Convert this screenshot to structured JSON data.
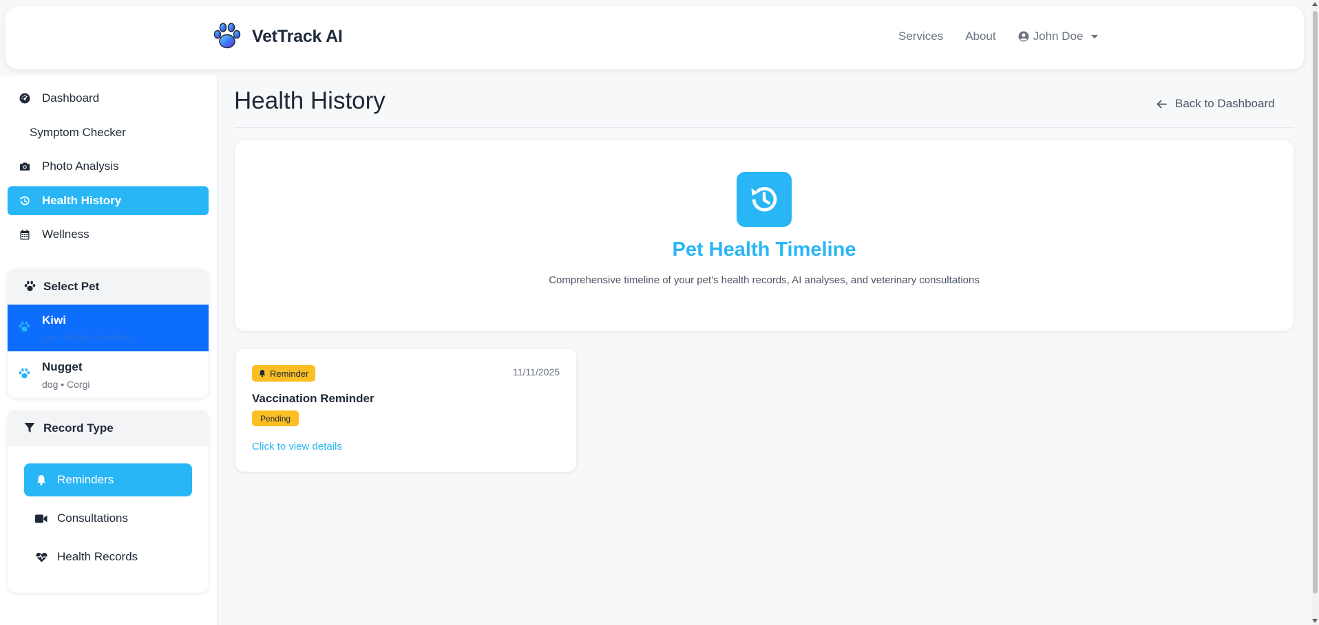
{
  "header": {
    "brand_name": "VetTrack AI",
    "nav": [
      "Services",
      "About"
    ],
    "user_name": "John Doe"
  },
  "sidebar": {
    "items": [
      {
        "label": "Dashboard",
        "icon": "gauge-icon",
        "active": false
      },
      {
        "label": "Symptom Checker",
        "icon": "",
        "active": false
      },
      {
        "label": "Photo Analysis",
        "icon": "camera-icon",
        "active": true
      },
      {
        "label": "Health History",
        "icon": "history-icon",
        "active": true
      },
      {
        "label": "Wellness",
        "icon": "calendar-icon",
        "active": false
      }
    ],
    "select_pet": {
      "title": "Select Pet",
      "pets": [
        {
          "name": "Kiwi",
          "meta": "cat • British Shorthair",
          "active": true
        },
        {
          "name": "Nugget",
          "meta": "dog • Corgi",
          "active": false
        }
      ]
    },
    "record_type": {
      "title": "Record Type",
      "items": [
        {
          "label": "Reminders",
          "icon": "bell-icon",
          "active": true
        },
        {
          "label": "Consultations",
          "icon": "video-icon",
          "active": false
        },
        {
          "label": "Health Records",
          "icon": "heart-pulse-icon",
          "active": false
        }
      ]
    }
  },
  "main": {
    "title": "Health History",
    "back_label": "Back to Dashboard",
    "hero": {
      "title": "Pet Health Timeline",
      "subtitle": "Comprehensive timeline of your pet's health records, AI analyses, and veterinary consultations"
    },
    "records": [
      {
        "type_badge": "Reminder",
        "date": "11/11/2025",
        "title": "Vaccination Reminder",
        "status": "Pending",
        "link": "Click to view details"
      }
    ]
  },
  "colors": {
    "accent": "#29b6f6",
    "selected_pet": "#0d6efd",
    "badge": "#fbbf24"
  }
}
